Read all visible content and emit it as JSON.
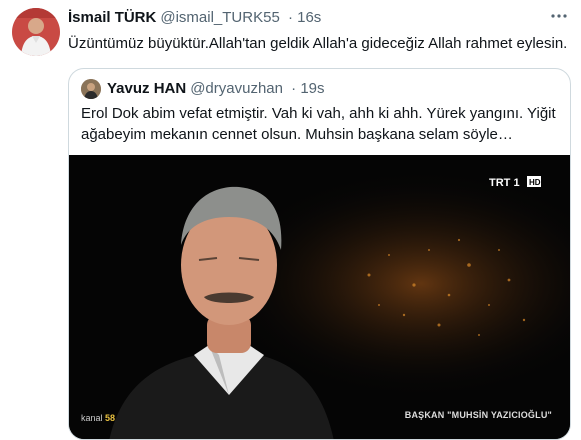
{
  "tweet": {
    "display_name": "İsmail TÜRK",
    "handle": "@ismail_TURK55",
    "time": "· 16s",
    "text": "Üzüntümüz büyüktür.Allah'tan geldik Allah'a gideceğiz Allah rahmet eylesin.",
    "more_icon": "more-horizontal-icon"
  },
  "quote": {
    "display_name": "Yavuz HAN",
    "handle": "@dryavuzhan",
    "time": "· 19s",
    "text_line1": "Erol Dok abim vefat etmiştir. Vah ki vah, ahh ki ahh. Yürek yangını. Yiğit",
    "text_line2": "ağabeyim mekanın cennet olsun. Muhsin başkana selam söyle…",
    "media": {
      "channel_logo": "TRT 1",
      "corner_left_text": "kanal",
      "corner_left_num": "58",
      "caption": "BAŞKAN \"MUHSİN YAZICIOĞLU\""
    }
  }
}
